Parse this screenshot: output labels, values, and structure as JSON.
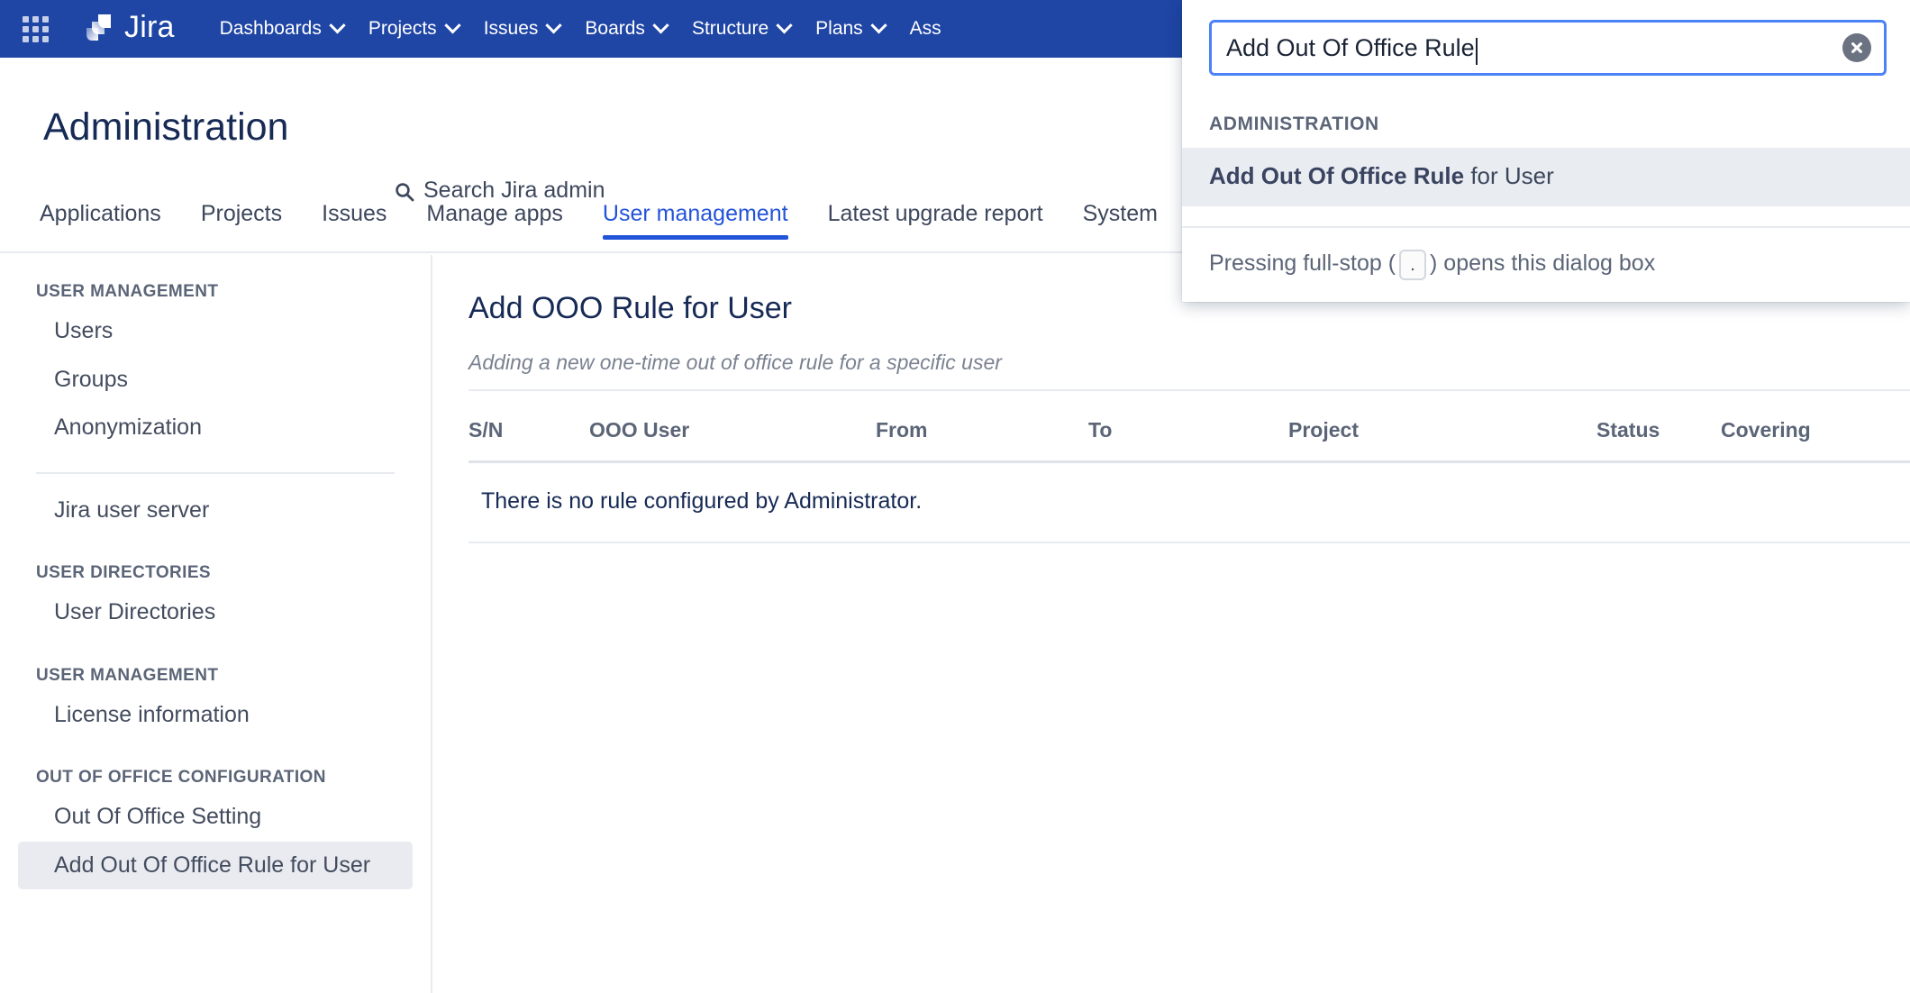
{
  "colors": {
    "nav_bg": "#1f45a5",
    "accent_blue": "#2353d8",
    "focus_blue": "#4c82f7",
    "heading_navy": "#162a55",
    "muted_text": "#5b6577",
    "row_highlight": "#e9ecf1"
  },
  "topnav": {
    "app_switcher_icon": "grid-apps-icon",
    "logo_icon": "jira-logo-icon",
    "logo_text": "Jira",
    "items": [
      {
        "label": "Dashboards",
        "has_chevron": true
      },
      {
        "label": "Projects",
        "has_chevron": true
      },
      {
        "label": "Issues",
        "has_chevron": true
      },
      {
        "label": "Boards",
        "has_chevron": true
      },
      {
        "label": "Structure",
        "has_chevron": true
      },
      {
        "label": "Plans",
        "has_chevron": true
      },
      {
        "label": "Ass",
        "has_chevron": false
      }
    ]
  },
  "header": {
    "title": "Administration",
    "search_icon": "search-icon",
    "search_label": "Search Jira admin"
  },
  "tabs": [
    {
      "label": "Applications",
      "active": false
    },
    {
      "label": "Projects",
      "active": false
    },
    {
      "label": "Issues",
      "active": false
    },
    {
      "label": "Manage apps",
      "active": false
    },
    {
      "label": "User management",
      "active": true
    },
    {
      "label": "Latest upgrade report",
      "active": false
    },
    {
      "label": "System",
      "active": false
    }
  ],
  "sidebar": {
    "groups": [
      {
        "heading": "USER MANAGEMENT",
        "items": [
          {
            "label": "Users",
            "active": false
          },
          {
            "label": "Groups",
            "active": false
          },
          {
            "label": "Anonymization",
            "active": false
          }
        ],
        "divider_after": true
      },
      {
        "heading": "",
        "items": [
          {
            "label": "Jira user server",
            "active": false
          }
        ],
        "divider_after": false
      },
      {
        "heading": "USER DIRECTORIES",
        "items": [
          {
            "label": "User Directories",
            "active": false
          }
        ],
        "divider_after": false
      },
      {
        "heading": "USER MANAGEMENT",
        "items": [
          {
            "label": "License information",
            "active": false
          }
        ],
        "divider_after": false
      },
      {
        "heading": "OUT OF OFFICE CONFIGURATION",
        "items": [
          {
            "label": "Out Of Office Setting",
            "active": false
          },
          {
            "label": "Add Out Of Office Rule for User",
            "active": true
          }
        ],
        "divider_after": false
      }
    ]
  },
  "main": {
    "title": "Add OOO Rule for User",
    "subtitle": "Adding a new one-time out of office rule for a specific user",
    "table": {
      "columns": [
        "S/N",
        "OOO User",
        "From",
        "To",
        "Project",
        "Status",
        "Covering"
      ],
      "rows": [],
      "empty_message": "There is no rule configured by Administrator."
    }
  },
  "search_dialog": {
    "input_value": "Add Out Of Office Rule",
    "input_placeholder": "Search Jira admin",
    "clear_icon": "clear-circle-x-icon",
    "section_label": "ADMINISTRATION",
    "results": [
      {
        "bold_part": "Add Out Of Office Rule",
        "rest_part": " for User"
      }
    ],
    "footer_prefix": "Pressing full-stop (",
    "footer_key": ".",
    "footer_suffix": ") opens this dialog box"
  }
}
